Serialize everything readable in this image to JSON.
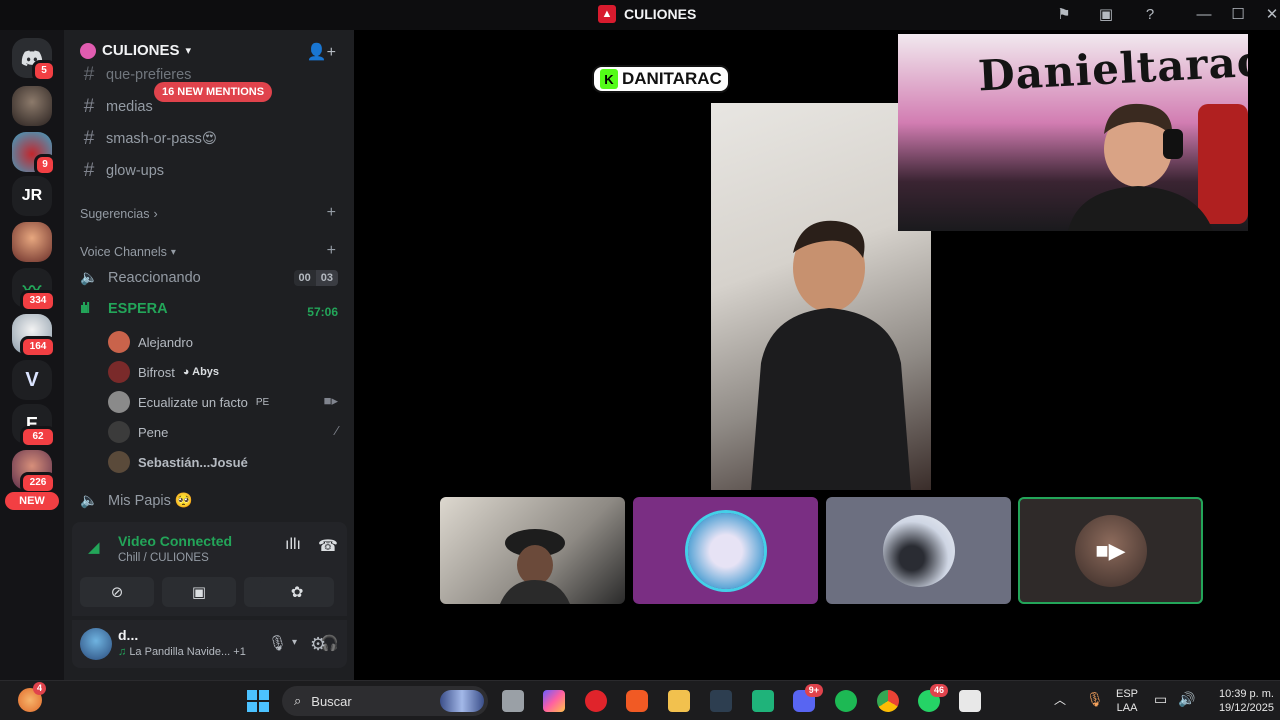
{
  "window": {
    "title": "CULIONES"
  },
  "rail": {
    "discord_badge": "5",
    "servers": [
      {
        "kind": "avatar",
        "badge": ""
      },
      {
        "kind": "avatar",
        "badge": "9"
      },
      {
        "kind": "text",
        "label": "JR",
        "badge": ""
      },
      {
        "kind": "avatar",
        "badge": ""
      },
      {
        "kind": "avatar",
        "badge": "334"
      },
      {
        "kind": "avatar",
        "badge": "164"
      },
      {
        "kind": "avatar",
        "badge": ""
      },
      {
        "kind": "avatar",
        "badge": "62"
      },
      {
        "kind": "avatar",
        "badge": "226"
      }
    ],
    "new_label": "NEW"
  },
  "sidebar": {
    "guild_name": "CULIONES",
    "channels": [
      {
        "name": "que-prefieres"
      },
      {
        "name": "medias"
      },
      {
        "name": "smash-or-pass😍"
      },
      {
        "name": "glow-ups"
      }
    ],
    "mentions_pill": "16 NEW MENTIONS",
    "categories": {
      "suggestions": "Sugerencias",
      "voice": "Voice Channels"
    },
    "voice_channels": [
      {
        "name": "Reaccionando",
        "count_a": "00",
        "count_b": "03"
      },
      {
        "name": "ESPERA",
        "timer": "57:06"
      },
      {
        "name": "Mis Papis 🥺"
      }
    ],
    "members": [
      {
        "name": "Alejandro",
        "tag": ""
      },
      {
        "name": "Bifrost",
        "tag": "◕ Abys"
      },
      {
        "name": "Ecualizate un facto",
        "tag": "PE"
      },
      {
        "name": "Pene",
        "tag": ""
      },
      {
        "name": "Sebastián...Josué",
        "tag": ""
      }
    ]
  },
  "voice_panel": {
    "status": "Video Connected",
    "location": "Chill / CULIONES"
  },
  "user_panel": {
    "name": "d...",
    "activity": "La Pandilla Navide...",
    "extra": "+1"
  },
  "stage": {
    "sticker_text": "DANITARAC",
    "sticker_icon": "K",
    "graffiti": "Danieltarac"
  },
  "taskbar": {
    "search_placeholder": "Buscar",
    "badge_discord": "9+",
    "badge_whatsapp": "46",
    "badge_weather": "4",
    "lang_top": "ESP",
    "lang_bottom": "LAA",
    "time": "10:39 p. m.",
    "date": "19/12/2025"
  }
}
